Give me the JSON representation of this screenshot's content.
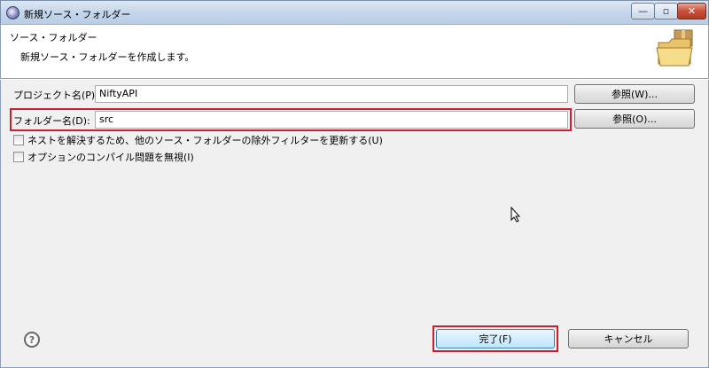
{
  "window": {
    "title": "新規ソース・フォルダー",
    "minimize_glyph": "—",
    "maximize_glyph": "▫",
    "close_glyph": "✕"
  },
  "banner": {
    "title": "ソース・フォルダー",
    "description": "新規ソース・フォルダーを作成します。",
    "icon": "folder-icon"
  },
  "form": {
    "project_label": "プロジェクト名(P):",
    "project_value": "NiftyAPI",
    "project_browse": "参照(W)...",
    "folder_label": "フォルダー名(D):",
    "folder_value": "src",
    "folder_browse": "参照(O)...",
    "checkbox_update_exclusion": "ネストを解決するため、他のソース・フォルダーの除外フィルターを更新する(U)",
    "checkbox_ignore_compile": "オプションのコンパイル問題を無視(I)"
  },
  "footer": {
    "help_glyph": "?",
    "finish": "完了(F)",
    "cancel": "キャンセル"
  },
  "colors": {
    "highlight": "#c8202e",
    "titlebar": "#c3d5ea"
  }
}
